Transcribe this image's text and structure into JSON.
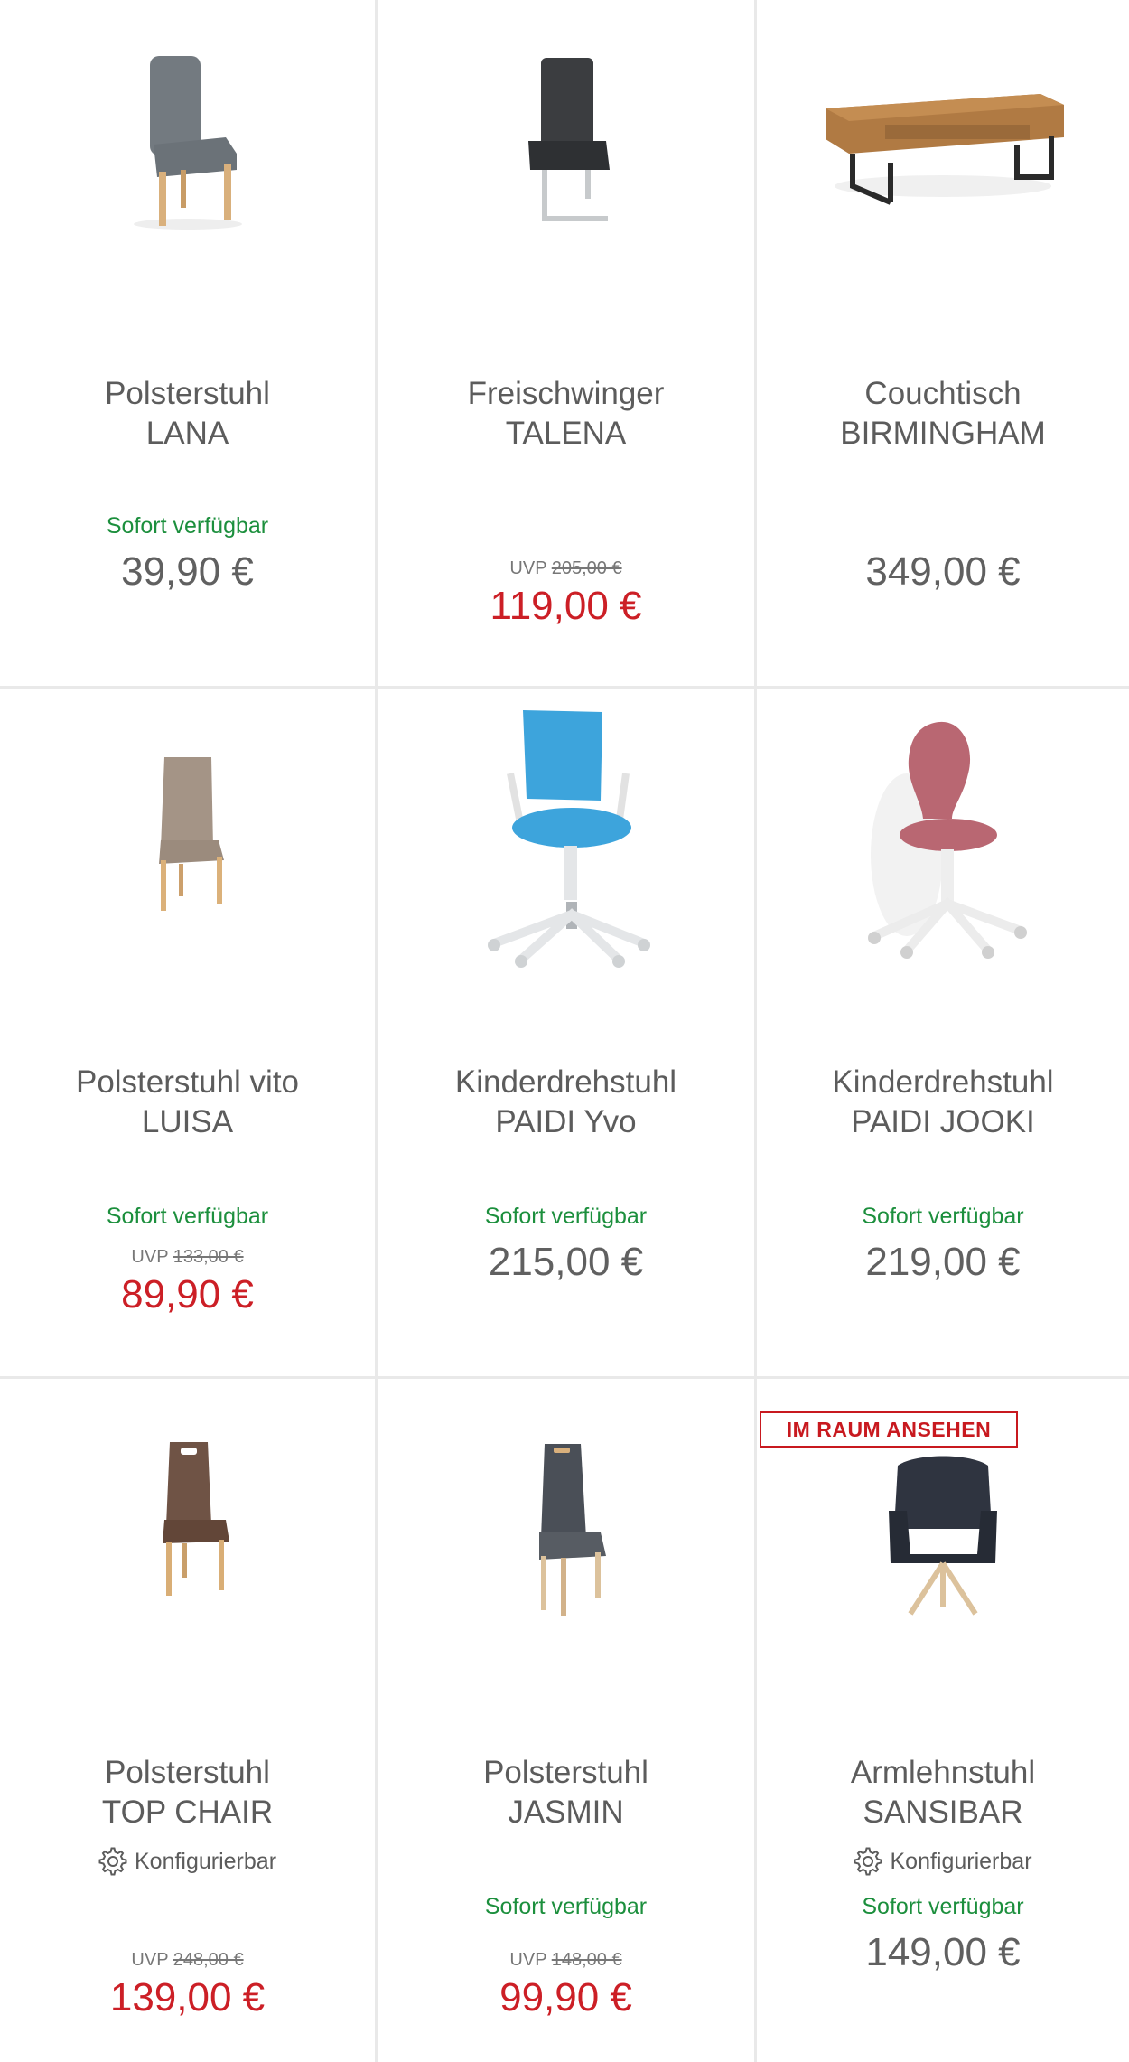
{
  "products": [
    {
      "category": "Polsterstuhl",
      "model": "LANA",
      "availability": "Sofort verfügbar",
      "price": "39,90 €",
      "icon": "grey-upholstered-chair-image"
    },
    {
      "category": "Freischwinger",
      "model": "TALENA",
      "uvp_label": "UVP",
      "uvp_price": "205,00 €",
      "price": "119,00 €",
      "icon": "cantilever-chair-image"
    },
    {
      "category": "Couchtisch",
      "model": "BIRMINGHAM",
      "price": "349,00 €",
      "icon": "coffee-table-image"
    },
    {
      "category": "Polsterstuhl vito",
      "model": "LUISA",
      "availability": "Sofort verfügbar",
      "uvp_label": "UVP",
      "uvp_price": "133,00 €",
      "price": "89,90 €",
      "icon": "beige-chair-image"
    },
    {
      "category": "Kinderdrehstuhl",
      "model": "PAIDI Yvo",
      "availability": "Sofort verfügbar",
      "price": "215,00 €",
      "icon": "blue-swivel-chair-image"
    },
    {
      "category": "Kinderdrehstuhl",
      "model": "PAIDI JOOKI",
      "availability": "Sofort verfügbar",
      "price": "219,00 €",
      "icon": "pink-swivel-chair-image"
    },
    {
      "category": "Polsterstuhl",
      "model": "TOP CHAIR",
      "config": "Konfigurierbar",
      "uvp_label": "UVP",
      "uvp_price": "248,00 €",
      "price": "139,00 €",
      "icon": "brown-chair-image"
    },
    {
      "category": "Polsterstuhl",
      "model": "JASMIN",
      "availability": "Sofort verfügbar",
      "uvp_label": "UVP",
      "uvp_price": "148,00 €",
      "price": "99,90 €",
      "icon": "anthracite-chair-image"
    },
    {
      "category": "Armlehnstuhl",
      "model": "SANSIBAR",
      "badge": "IM RAUM ANSEHEN",
      "config": "Konfigurierbar",
      "availability": "Sofort verfügbar",
      "price": "149,00 €",
      "icon": "armchair-image"
    }
  ],
  "colors": {
    "available": "#1c8f3d",
    "sale": "#cc1f26",
    "badge": "#c8191f",
    "text": "#5c5c5c"
  }
}
